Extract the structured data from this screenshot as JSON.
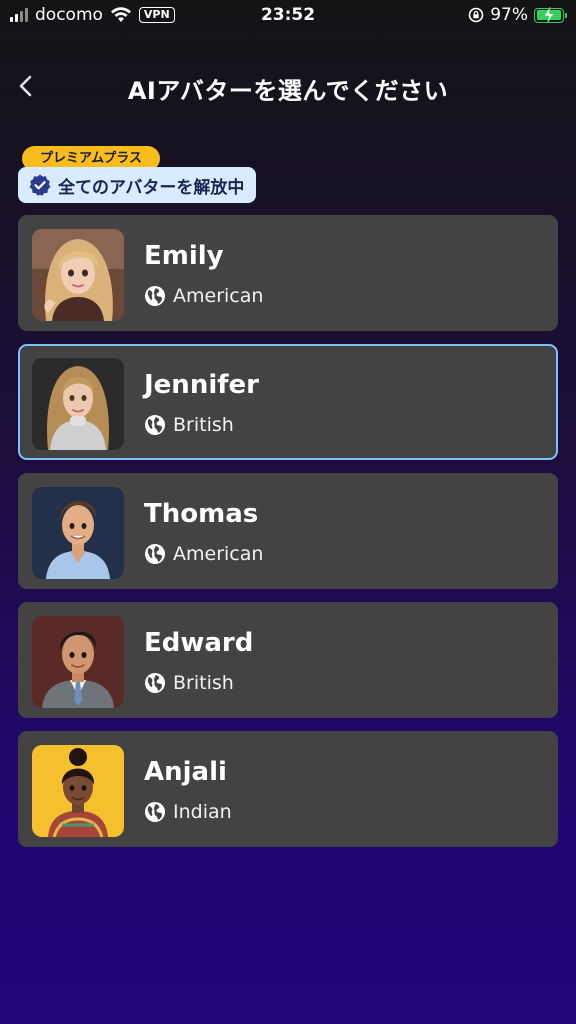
{
  "status_bar": {
    "carrier": "docomo",
    "vpn": "VPN",
    "time": "23:52",
    "battery": "97%",
    "battery_level": 0.97,
    "battery_color": "#35d05a"
  },
  "header": {
    "title": "AIアバターを選んでください",
    "back_icon": "chevron-left-icon"
  },
  "premium": {
    "tag": "プレミアムプラス",
    "message": "全てのアバターを解放中",
    "tag_color": "#f7bd1c",
    "badge_color": "#d9ecff"
  },
  "avatars": [
    {
      "name": "Emily",
      "origin": "American",
      "selected": false
    },
    {
      "name": "Jennifer",
      "origin": "British",
      "selected": true
    },
    {
      "name": "Thomas",
      "origin": "American",
      "selected": false
    },
    {
      "name": "Edward",
      "origin": "British",
      "selected": false
    },
    {
      "name": "Anjali",
      "origin": "Indian",
      "selected": false
    }
  ],
  "colors": {
    "card_background": "#434343",
    "selected_border": "#7cc0ff",
    "background_top": "#141416",
    "background_bottom": "#230678"
  }
}
